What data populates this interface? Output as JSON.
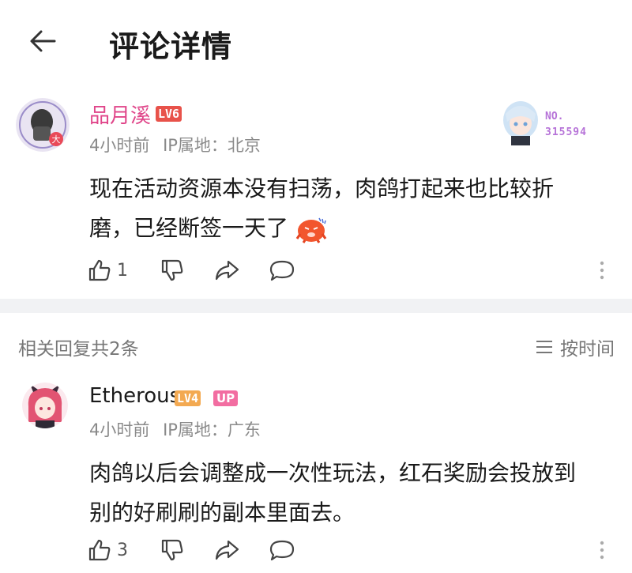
{
  "header": {
    "title": "评论详情"
  },
  "main_comment": {
    "username": "品月溪",
    "level": "LV6",
    "time": "4小时前",
    "ip": "IP属地：北京",
    "text": "现在活动资源本没有扫荡，肉鸽打起来也比较折磨，已经断签一天了",
    "likes": "1",
    "fan_card": {
      "label": "NO.",
      "number": "315594"
    }
  },
  "replies_header": {
    "count_label": "相关回复共2条",
    "sort_label": "按时间"
  },
  "reply": {
    "username": "Etherous",
    "level": "LV4",
    "up_badge": "UP",
    "time": "4小时前",
    "ip": "IP属地：广东",
    "text": "肉鸽以后会调整成一次性玩法，红石奖励会投放到别的好刷刷的副本里面去。",
    "likes": "3"
  },
  "colors": {
    "accent_pink": "#e0468a",
    "lv6": "#e8524a",
    "lv4": "#f3a951",
    "up": "#f26da1",
    "meta_gray": "#8a8a8a",
    "divider": "#f1f2f4"
  }
}
